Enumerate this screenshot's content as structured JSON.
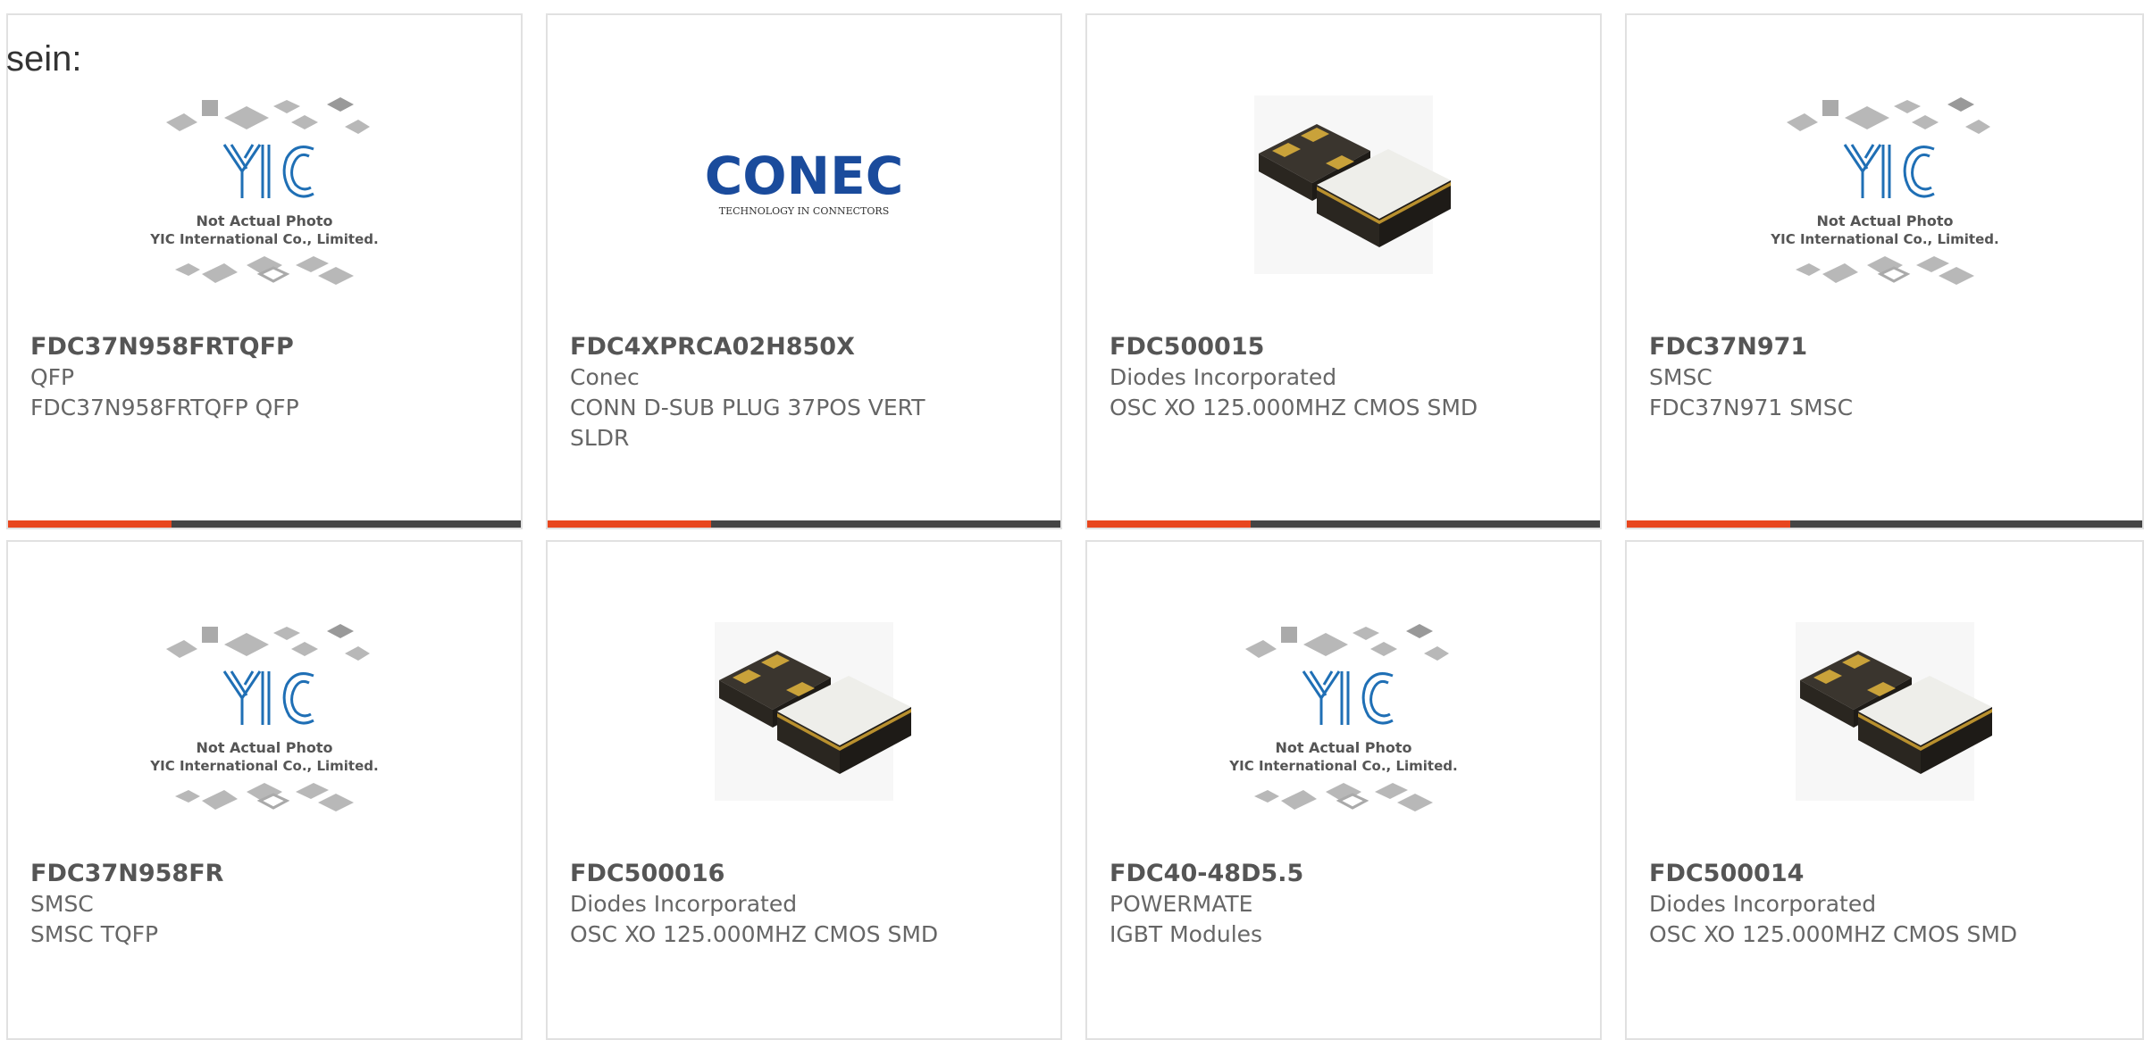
{
  "lead": "sein:",
  "colors": {
    "accent": "#e8461e",
    "bar": "#444444",
    "border": "#e1e1e1"
  },
  "products": [
    {
      "part": "FDC37N958FRTQFP",
      "maker": "QFP",
      "desc": "FDC37N958FRTQFP QFP",
      "image": "yic-placeholder-image"
    },
    {
      "part": "FDC4XPRCA02H850X",
      "maker": "Conec",
      "desc": "CONN D-SUB PLUG 37POS VERT SLDR",
      "image": "conec-logo-image",
      "logo_text": "CONEC",
      "logo_tag": "TECHNOLOGY IN CONNECTORS"
    },
    {
      "part": "FDC500015",
      "maker": "Diodes Incorporated",
      "desc": "OSC XO 125.000MHZ CMOS SMD",
      "image": "oscillator-image"
    },
    {
      "part": "FDC37N971",
      "maker": "SMSC",
      "desc": "FDC37N971 SMSC",
      "image": "yic-placeholder-image"
    },
    {
      "part": "FDC37N958FR",
      "maker": "SMSC",
      "desc": "SMSC TQFP",
      "image": "yic-placeholder-image"
    },
    {
      "part": "FDC500016",
      "maker": "Diodes Incorporated",
      "desc": "OSC XO 125.000MHZ CMOS SMD",
      "image": "oscillator-image"
    },
    {
      "part": "FDC40-48D5.5",
      "maker": "POWERMATE",
      "desc": "IGBT Modules",
      "image": "yic-placeholder-image"
    },
    {
      "part": "FDC500014",
      "maker": "Diodes Incorporated",
      "desc": "OSC XO 125.000MHZ CMOS SMD",
      "image": "oscillator-image"
    }
  ],
  "placeholder": {
    "logo": "YIC",
    "line1": "Not Actual Photo",
    "line2": "YIC International Co., Limited."
  }
}
